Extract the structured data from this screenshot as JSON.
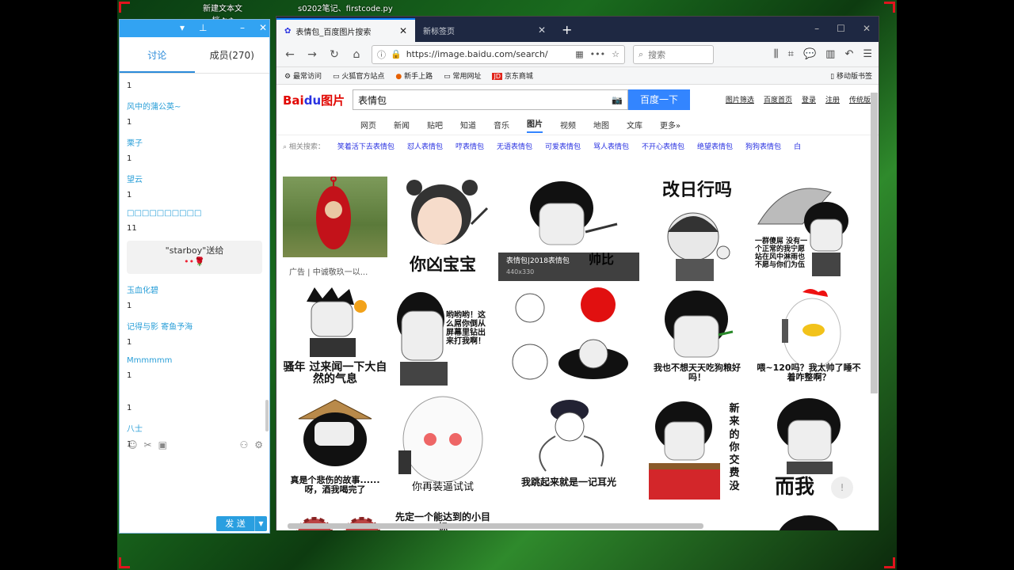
{
  "desktop": {
    "icon1_line1": "新建文本文",
    "icon1_line2": "档.txt",
    "icon2": "s0202笔记、firstcode.py"
  },
  "chat": {
    "tabs": [
      "讨论",
      "成员(270)"
    ],
    "messages": [
      {
        "name": "",
        "text": "1"
      },
      {
        "name": "风中的蒲公英~",
        "text": "1"
      },
      {
        "name": "栗子",
        "text": "1"
      },
      {
        "name": "望云",
        "text": "1"
      },
      {
        "name": "□□□□□□□□□□",
        "text": "11"
      }
    ],
    "gift_text": "\"starboy\"送给",
    "gift_flower": "••🌹",
    "messages2": [
      {
        "name": "玉血化碧",
        "text": "1"
      },
      {
        "name": "记得与影 寄鱼予海",
        "text": "1"
      },
      {
        "name": "Mmmmmm",
        "text": "1"
      },
      {
        "name": "",
        "text": "1"
      },
      {
        "name": "八士",
        "text": "1"
      }
    ],
    "send_label": "发 送"
  },
  "browser": {
    "tabs": [
      {
        "title": "表情包_百度图片搜索",
        "active": true
      },
      {
        "title": "新标签页",
        "active": false
      }
    ],
    "url": "https://image.baidu.com/search/",
    "search_placeholder": "搜索",
    "bookmarks": [
      "最常访问",
      "火狐官方站点",
      "新手上路",
      "常用网址",
      "京东商城"
    ],
    "mobile_bookmarks": "移动版书签"
  },
  "baidu": {
    "logo_a": "Bai",
    "logo_b": "du",
    "logo_c": "图片",
    "query": "表情包",
    "search_button": "百度一下",
    "top_links": [
      "图片筛选",
      "百度首页",
      "登录",
      "注册",
      "传统版"
    ],
    "channels": [
      "网页",
      "新闻",
      "贴吧",
      "知道",
      "音乐",
      "图片",
      "视频",
      "地图",
      "文库",
      "更多»"
    ],
    "active_channel": "图片",
    "related_label": "相关搜索：",
    "related": [
      "笑着活下去表情包",
      "怼人表情包",
      "哼表情包",
      "无语表情包",
      "可爱表情包",
      "骂人表情包",
      "不开心表情包",
      "绝望表情包",
      "狗狗表情包",
      "白"
    ],
    "ad_caption": "广告 | 中诚敬玖一以...",
    "hover_title": "表情包|2018表情包",
    "hover_dims": "440x330",
    "captions": {
      "c2": "你凶宝宝",
      "c3": "帅比",
      "c4": "改日行吗",
      "c5": "一群傻屌 没有一个正常的我宁愿站在风中淋雨也不愿与你们为伍",
      "c6": "骚年 过来闻一下大自然的气息",
      "c7": "哟哟哟！这么屌你倒从屏幕里钻出来打我啊！",
      "c9": "我也不想天天吃狗粮好吗！",
      "c10": "喂~120吗？我太帅了睡不着咋整啊？",
      "c11": "真是个悲伤的故事......呀，酒我喝完了",
      "c12": "你再装逼试试",
      "c13": "我跳起来就是一记耳光",
      "c14": "新来的 你交费没",
      "c15": "而我",
      "c16": "先定一个能达到的小目标"
    }
  }
}
